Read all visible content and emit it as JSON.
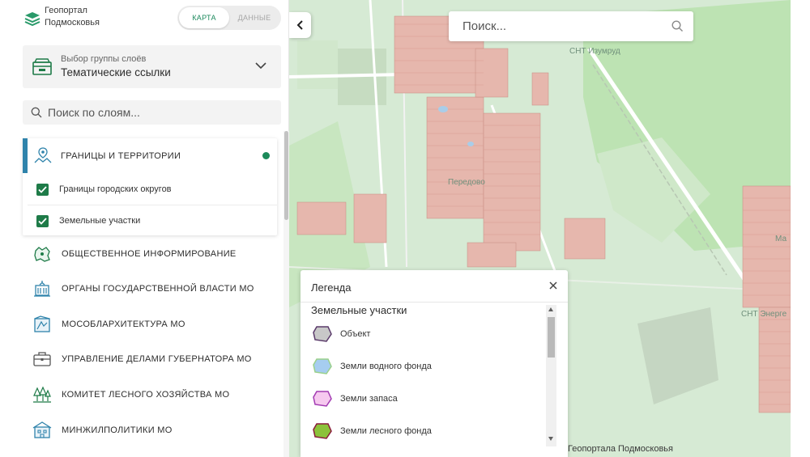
{
  "app": {
    "title": "Геопортал\nПодмосковья",
    "brand_color": "#1e8a5e"
  },
  "mode_switch": {
    "tabs": [
      {
        "label": "КАРТА",
        "active": true
      },
      {
        "label": "ДАННЫЕ",
        "active": false
      }
    ]
  },
  "layer_group": {
    "label": "Выбор группы слоёв",
    "value": "Тематические ссылки"
  },
  "layer_search": {
    "placeholder": "Поиск по слоям..."
  },
  "categories": [
    {
      "label": "ГРАНИЦЫ И ТЕРРИТОРИИ",
      "icon": "territory-pin-icon",
      "expanded": true,
      "active": true,
      "layers": [
        {
          "label": "Границы городских округов",
          "checked": true
        },
        {
          "label": "Земельные участки",
          "checked": true
        }
      ]
    },
    {
      "label": "ОБЩЕСТВЕННОЕ ИНФОРМИРОВАНИЕ",
      "icon": "region-map-icon"
    },
    {
      "label": "ОРГАНЫ ГОСУДАРСТВЕННОЙ ВЛАСТИ МО",
      "icon": "government-building-icon"
    },
    {
      "label": "МОСОБЛАРХИТЕКТУРА МО",
      "icon": "architecture-blueprint-icon"
    },
    {
      "label": "УПРАВЛЕНИЕ ДЕЛАМИ ГУБЕРНАТОРА МО",
      "icon": "briefcase-icon"
    },
    {
      "label": "КОМИТЕТ ЛЕСНОГО ХОЗЯЙСТВА МО",
      "icon": "trees-icon"
    },
    {
      "label": "МИНЖИЛПОЛИТИКИ МО",
      "icon": "housing-icon"
    }
  ],
  "map": {
    "search_placeholder": "Поиск...",
    "labels": {
      "snt_izumrud": "СНТ Изумруд",
      "peredovo": "Передово",
      "snt_energe": "СНТ Энерге",
      "ma": "Ма"
    },
    "attribution": "Геопортала Подмосковья"
  },
  "legend": {
    "title": "Легенда",
    "section": "Земельные участки",
    "items": [
      {
        "label": "Объект",
        "fill": "#c8c8c8",
        "stroke": "#5a3a6a"
      },
      {
        "label": "Земли водного фонда",
        "fill": "#a6cdf0",
        "stroke": "#9ad08a"
      },
      {
        "label": "Земли запаса",
        "fill": "#f6c9ef",
        "stroke": "#a23ab2"
      },
      {
        "label": "Земли лесного фонда",
        "fill": "#8cc23a",
        "stroke": "#8a1a3a"
      }
    ]
  }
}
